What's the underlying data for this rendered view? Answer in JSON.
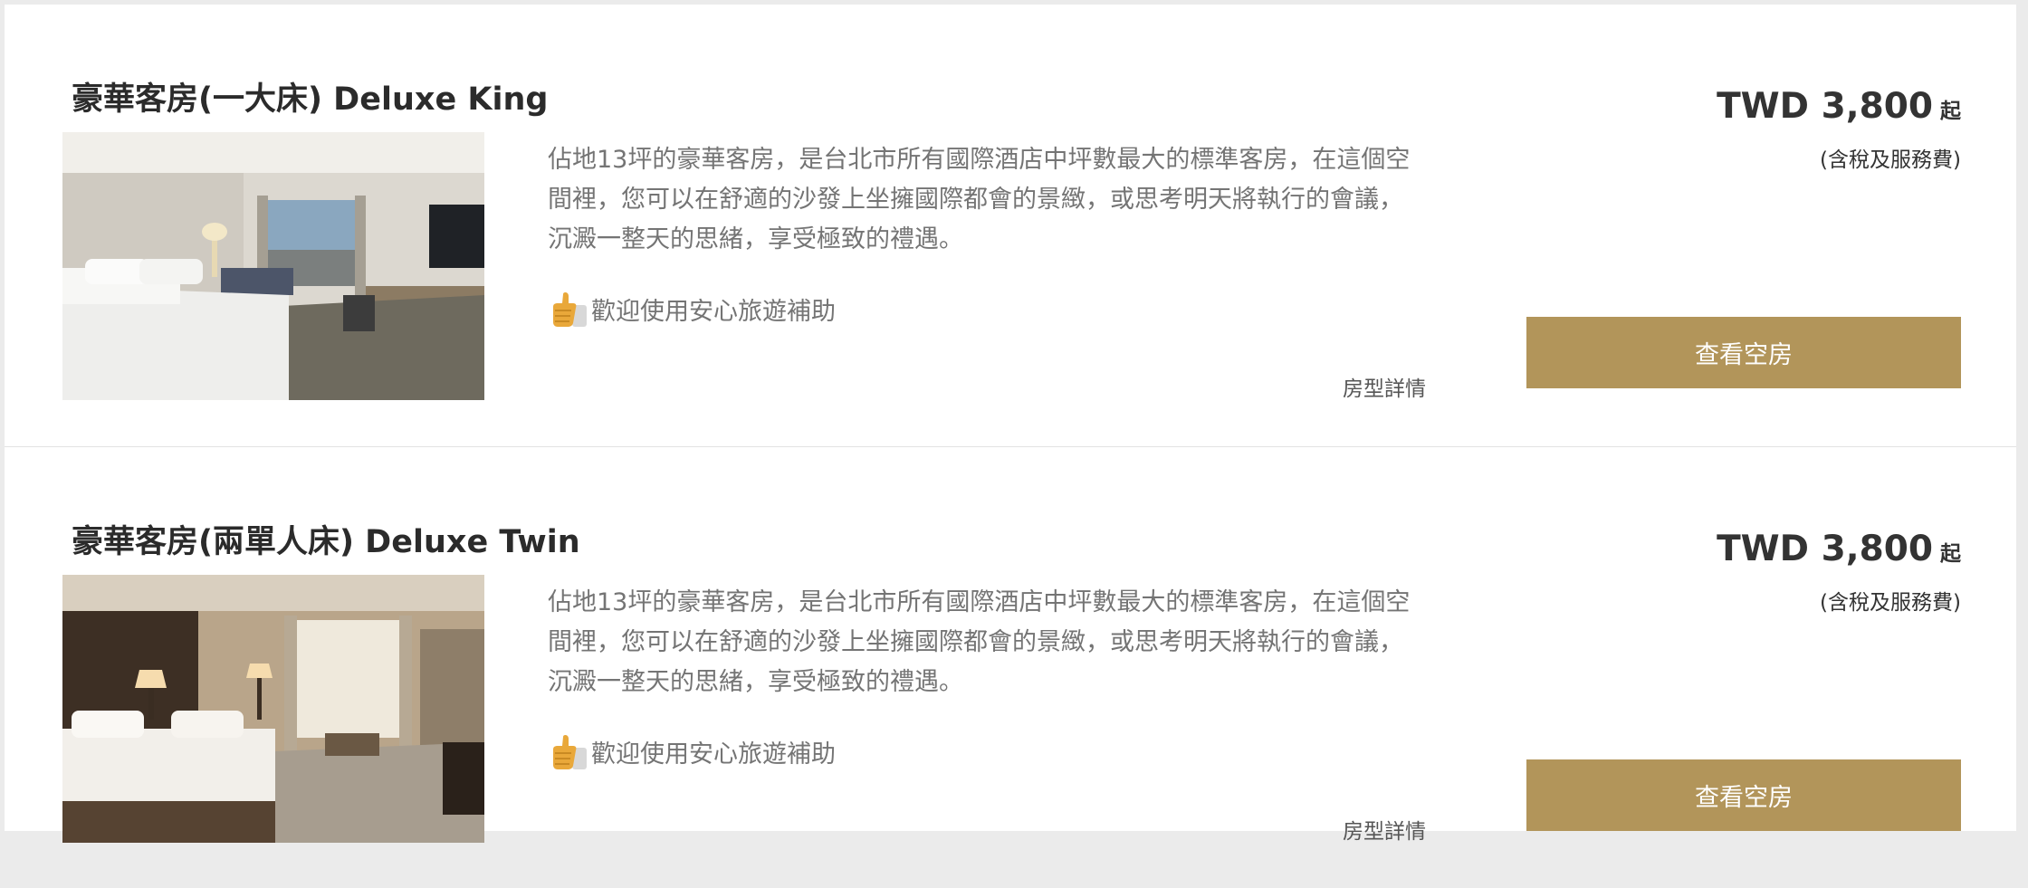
{
  "rooms": [
    {
      "title": "豪華客房(一大床) Deluxe King",
      "description": "佔地13坪的豪華客房，是台北市所有國際酒店中坪數最大的標準客房，在這個空間裡，您可以在舒適的沙發上坐擁國際都會的景緻，或思考明天將執行的會議，沉澱一整天的思緒，享受極致的禮遇。",
      "promo_icon": "thumbs-up-icon",
      "promo": "歡迎使用安心旅遊補助",
      "details_link": "房型詳情",
      "price": "TWD 3,800",
      "price_suffix": "起",
      "price_note": "(含稅及服務費)",
      "button": "查看空房"
    },
    {
      "title": "豪華客房(兩單人床) Deluxe Twin",
      "description": "佔地13坪的豪華客房，是台北市所有國際酒店中坪數最大的標準客房，在這個空間裡，您可以在舒適的沙發上坐擁國際都會的景緻，或思考明天將執行的會議，沉澱一整天的思緒，享受極致的禮遇。",
      "promo_icon": "thumbs-up-icon",
      "promo": "歡迎使用安心旅遊補助",
      "details_link": "房型詳情",
      "price": "TWD 3,800",
      "price_suffix": "起",
      "price_note": "(含稅及服務費)",
      "button": "查看空房"
    }
  ],
  "colors": {
    "accent_button": "#b2955a",
    "text_muted": "#747474",
    "text_dark": "#2b2b2b",
    "page_background": "#ebebeb"
  }
}
